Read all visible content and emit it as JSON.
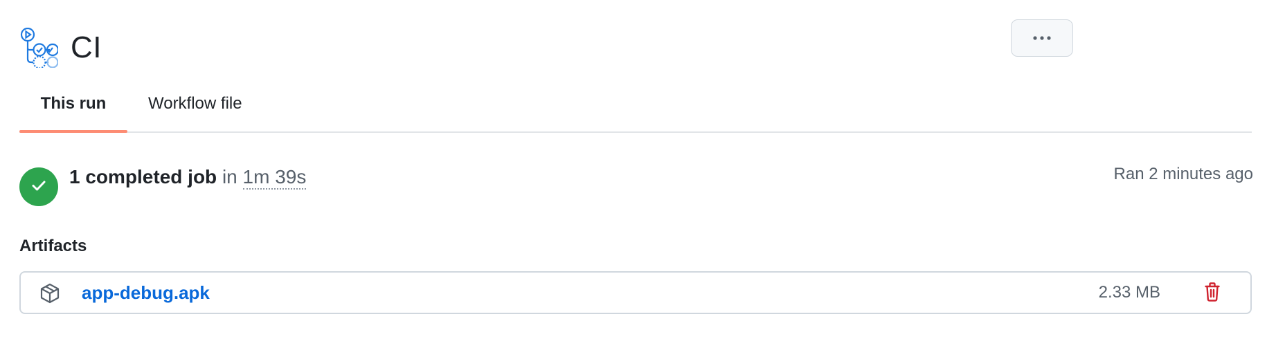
{
  "workflow": {
    "title": "CI",
    "icon": "workflow-icon",
    "more_icon": "kebab-horizontal-icon"
  },
  "tabs": [
    {
      "label": "This run",
      "active": true
    },
    {
      "label": "Workflow file",
      "active": false
    }
  ],
  "summary": {
    "status_icon": "check-icon",
    "jobs": "1 completed job",
    "in_text": "in",
    "duration": "1m 39s",
    "ran": "Ran 2 minutes ago"
  },
  "artifacts": {
    "heading": "Artifacts",
    "items": [
      {
        "icon": "package-icon",
        "name": "app-debug.apk",
        "size": "2.33 MB",
        "delete_icon": "trash-icon"
      }
    ]
  },
  "colors": {
    "success": "#2da44e",
    "link": "#0969da",
    "danger": "#cf222e",
    "tab_underline": "#fd8c73",
    "icon_blue": "#0969da"
  }
}
